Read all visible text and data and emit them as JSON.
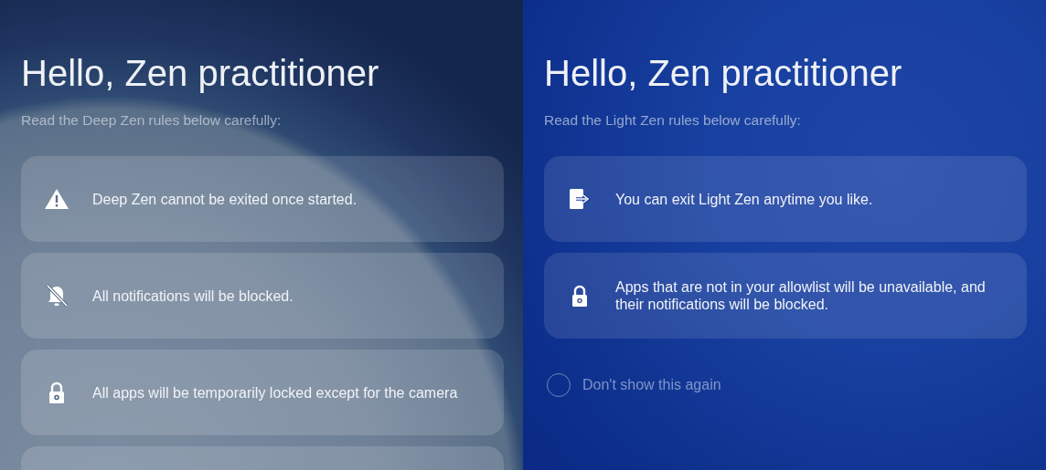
{
  "panels": [
    {
      "title": "Hello, Zen practitioner",
      "subtitle": "Read the Deep Zen rules below carefully:",
      "rules": [
        {
          "kind": "warning",
          "text": "Deep Zen cannot be exited once started."
        },
        {
          "kind": "silenced",
          "text": "All notifications will be blocked."
        },
        {
          "kind": "locked",
          "text": "All apps will be temporarily locked except for the camera"
        },
        {
          "kind": "blank"
        }
      ]
    },
    {
      "title": "Hello, Zen practitioner",
      "subtitle": "Read the Light Zen rules below carefully:",
      "rules": [
        {
          "kind": "exit",
          "text": "You can exit Light Zen anytime you like."
        },
        {
          "kind": "locked",
          "text": "Apps that are not in your allowlist will be unavailable, and their notifications will be blocked."
        }
      ],
      "option": {
        "label": "Don't show this again",
        "checked": false
      }
    }
  ]
}
